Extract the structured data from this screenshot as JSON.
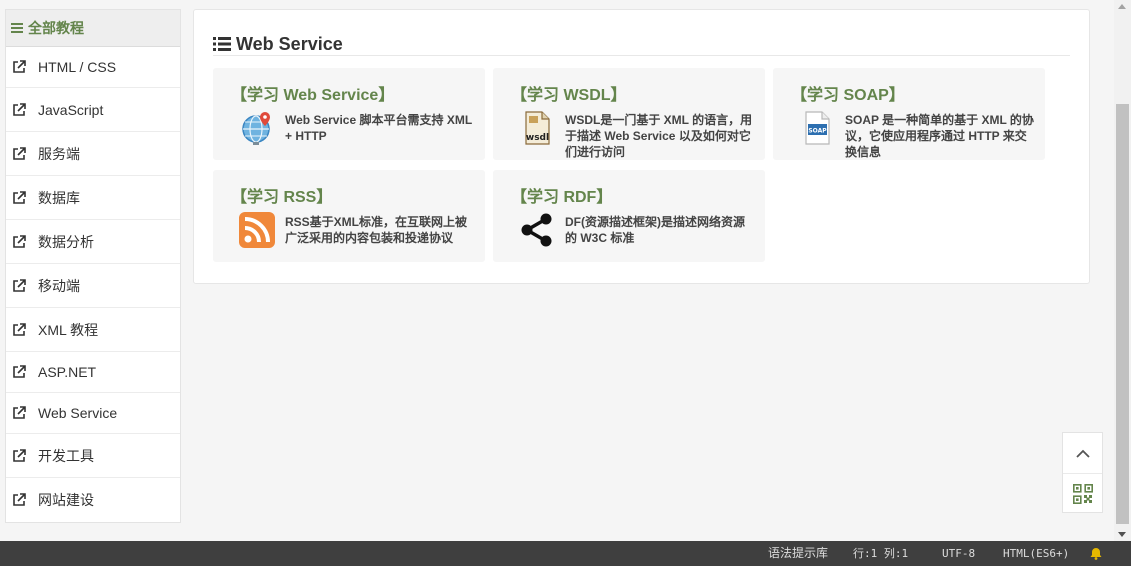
{
  "sidebar": {
    "header": "全部教程",
    "items": [
      {
        "label": "HTML / CSS"
      },
      {
        "label": "JavaScript"
      },
      {
        "label": "服务端"
      },
      {
        "label": "数据库"
      },
      {
        "label": "数据分析"
      },
      {
        "label": "移动端"
      },
      {
        "label": "XML 教程"
      },
      {
        "label": "ASP.NET"
      },
      {
        "label": "Web Service"
      },
      {
        "label": "开发工具"
      },
      {
        "label": "网站建设"
      }
    ]
  },
  "main": {
    "title": "Web Service",
    "cards": [
      {
        "title": "【学习 Web Service】",
        "desc": "Web Service 脚本平台需支持 XML + HTTP",
        "icon": "globe-pin-icon"
      },
      {
        "title": "【学习 WSDL】",
        "desc": "WSDL是一门基于 XML 的语言，用于描述 Web Service 以及如何对它们进行访问",
        "icon": "wsdl-file-icon",
        "icon_text": "wsdl"
      },
      {
        "title": "【学习 SOAP】",
        "desc": "SOAP 是一种简单的基于 XML 的协议，它使应用程序通过 HTTP 来交换信息",
        "icon": "soap-file-icon",
        "icon_text": "SOAP"
      },
      {
        "title": "【学习 RSS】",
        "desc": "RSS基于XML标准，在互联网上被广泛采用的内容包装和投递协议",
        "icon": "rss-icon"
      },
      {
        "title": "【学习 RDF】",
        "desc": "DF(资源描述框架)是描述网络资源的 W3C 标准",
        "icon": "rdf-share-icon"
      }
    ]
  },
  "statusbar": {
    "hint_lib": "语法提示库",
    "position": "行:1 列:1",
    "encoding": "UTF-8",
    "language": "HTML(ES6+)"
  },
  "colors": {
    "accent": "#64854c",
    "statusbar_bg": "#3f3f3f",
    "rss_orange": "#f0883a"
  }
}
